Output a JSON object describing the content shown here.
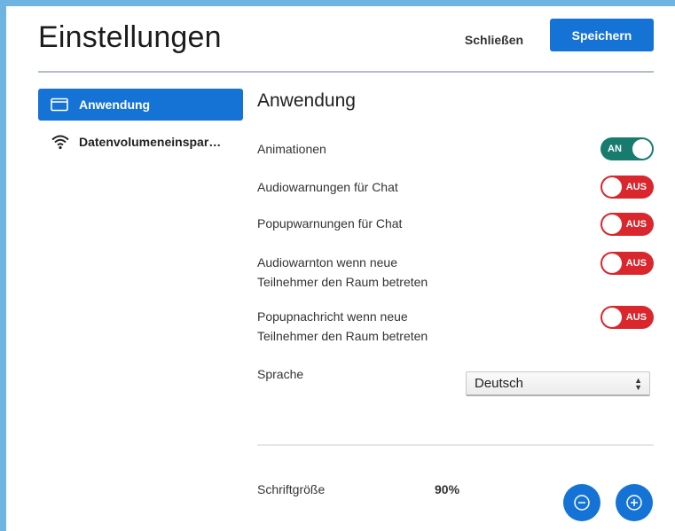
{
  "header": {
    "title": "Einstellungen",
    "close_label": "Schließen",
    "save_label": "Speichern"
  },
  "sidebar": {
    "items": [
      {
        "label": "Anwendung",
        "icon": "window-icon",
        "active": true
      },
      {
        "label": "Datenvolumeneinspar…",
        "icon": "wifi-icon",
        "active": false
      }
    ]
  },
  "main": {
    "title": "Anwendung",
    "settings": [
      {
        "label": "Animationen",
        "state": "AN"
      },
      {
        "label": "Audiowarnungen für Chat",
        "state": "AUS"
      },
      {
        "label": "Popupwarnungen für Chat",
        "state": "AUS"
      },
      {
        "label_line1": "Audiowarnton wenn neue",
        "label_line2": "Teilnehmer den Raum betreten",
        "state": "AUS"
      },
      {
        "label_line1": "Popupnachricht wenn neue",
        "label_line2": "Teilnehmer den Raum betreten",
        "state": "AUS"
      }
    ],
    "language": {
      "label": "Sprache",
      "value": "Deutsch"
    },
    "font_size": {
      "label": "Schriftgröße",
      "value": "90%"
    }
  },
  "colors": {
    "accent": "#1673d6",
    "toggle_on": "#177c6e",
    "toggle_off": "#d9272d"
  }
}
